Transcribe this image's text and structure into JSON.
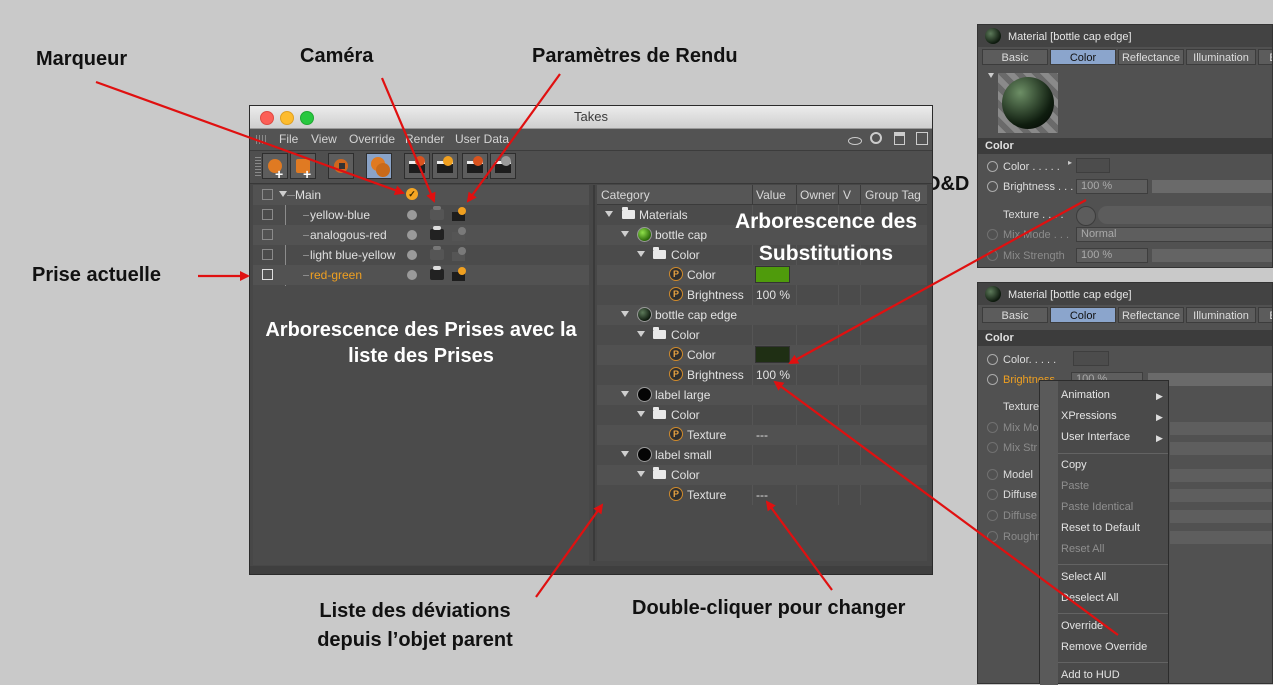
{
  "annotations": {
    "marqueur": "Marqueur",
    "camera": "Caméra",
    "render_settings": "Paramètres de Rendu",
    "current_take": "Prise actuelle",
    "dnd": "D&D",
    "override_tree": "Arborescence des Substitutions",
    "takes_tree": "Arborescence des Prises avec la liste des Prises",
    "deviations": "Liste des déviations depuis l’objet parent",
    "double_click": "Double-cliquer pour changer"
  },
  "takes_window": {
    "title": "Takes",
    "menu": [
      "File",
      "View",
      "Override",
      "Render",
      "User Data"
    ],
    "takes": [
      {
        "name": "Main"
      },
      {
        "name": "yellow-blue"
      },
      {
        "name": "analogous-red"
      },
      {
        "name": "light blue-yellow"
      },
      {
        "name": "red-green"
      }
    ],
    "columns": [
      "Category",
      "Value",
      "Owner",
      "V",
      "Group Tag"
    ],
    "overrides": {
      "materials": "Materials",
      "bottle_cap": "bottle cap",
      "bottle_cap_edge": "bottle cap edge",
      "label_large": "label large",
      "label_small": "label small",
      "color_folder": "Color",
      "color": "Color",
      "brightness": "Brightness",
      "texture": "Texture",
      "brightness_value": "100 %",
      "texture_value": "---",
      "green_swatch": "#4f9b0c",
      "dark_swatch": "#1f2f14"
    }
  },
  "material_panel_top": {
    "title": "Material [bottle cap edge]",
    "tabs": [
      "Basic",
      "Color",
      "Reflectance",
      "Illumination",
      "E"
    ],
    "section": "Color",
    "color_label": "Color . . . . .",
    "brightness_label": "Brightness . . .",
    "brightness_value": "100 %",
    "texture_label": "Texture . . . .",
    "mix_mode_label": "Mix Mode . . .",
    "mix_mode_value": "Normal",
    "mix_strength_label": "Mix Strength",
    "mix_strength_value": "100 %"
  },
  "material_panel_bottom": {
    "title": "Material [bottle cap edge]",
    "tabs": [
      "Basic",
      "Color",
      "Reflectance",
      "Illumination",
      "E"
    ],
    "section": "Color",
    "color_label": "Color. . . . .",
    "brightness_label": "Brightness",
    "brightness_value": "100 %",
    "texture_label": "Texture",
    "mix_mode_label": "Mix Mo",
    "mix_strength_label": "Mix Str",
    "model_label": "Model",
    "diffuse1_label": "Diffuse",
    "diffuse2_label": "Diffuse",
    "rough_label": "Roughn"
  },
  "context_menu": {
    "animation": "Animation",
    "xpressions": "XPressions",
    "user_interface": "User Interface",
    "copy": "Copy",
    "paste": "Paste",
    "paste_identical": "Paste Identical",
    "reset_default": "Reset to Default",
    "reset_all": "Reset All",
    "select_all": "Select All",
    "deselect_all": "Deselect All",
    "override": "Override",
    "remove_override": "Remove Override",
    "add_to_hud": "Add to HUD"
  },
  "colors": {
    "current_take": "#f0a020",
    "arrow": "#e01010",
    "selected_tab": "#8ba5cc"
  }
}
